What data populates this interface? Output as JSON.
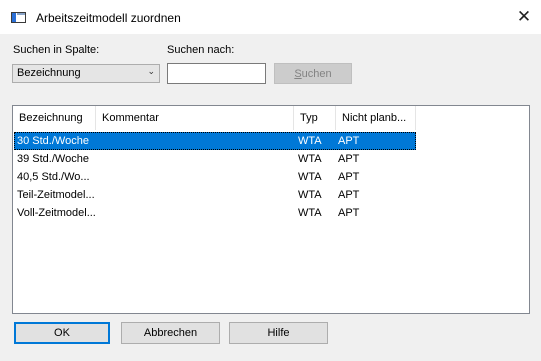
{
  "window": {
    "title": "Arbeitszeitmodell zuordnen",
    "close_symbol": "✕"
  },
  "search": {
    "column_label": "Suchen in Spalte:",
    "column_value": "Bezeichnung",
    "term_label": "Suchen nach:",
    "term_value": "",
    "button_rest_label": "uchen",
    "button_accel": "S"
  },
  "table": {
    "columns": [
      "Bezeichnung",
      "Kommentar",
      "Typ",
      "Nicht planb..."
    ],
    "rows": [
      {
        "bezeichnung": "30 Std./Woche",
        "kommentar": "",
        "typ": "WTA",
        "nicht_planbar": "APT",
        "selected": true
      },
      {
        "bezeichnung": "39 Std./Woche",
        "kommentar": "",
        "typ": "WTA",
        "nicht_planbar": "APT",
        "selected": false
      },
      {
        "bezeichnung": "40,5 Std./Wo...",
        "kommentar": "",
        "typ": "WTA",
        "nicht_planbar": "APT",
        "selected": false
      },
      {
        "bezeichnung": "Teil-Zeitmodel...",
        "kommentar": "",
        "typ": "WTA",
        "nicht_planbar": "APT",
        "selected": false
      },
      {
        "bezeichnung": "Voll-Zeitmodel...",
        "kommentar": "",
        "typ": "WTA",
        "nicht_planbar": "APT",
        "selected": false
      }
    ]
  },
  "buttons": {
    "ok": "OK",
    "cancel": "Abbrechen",
    "help": "Hilfe"
  },
  "icons": {
    "app": "window-app-icon",
    "close": "close-icon",
    "dropdown": "chevron-down-icon"
  },
  "colors": {
    "selection": "#0078d7",
    "dialog_bg": "#f0f0f0"
  }
}
